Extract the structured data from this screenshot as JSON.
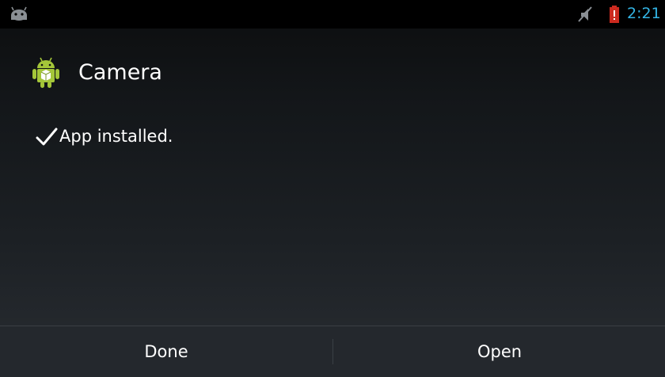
{
  "status_bar": {
    "time": "2:21",
    "notification_icon": "android-debug-icon",
    "mute_icon": "mute-icon",
    "battery_icon": "battery-low-icon",
    "clock_color": "#33b5e5",
    "battery_alert_color": "#cc2a1f"
  },
  "app": {
    "name": "Camera",
    "icon": "android-package-icon",
    "icon_color": "#a4c639"
  },
  "message": {
    "text": "App installed.",
    "icon": "checkmark-icon"
  },
  "buttons": {
    "done_label": "Done",
    "open_label": "Open"
  }
}
